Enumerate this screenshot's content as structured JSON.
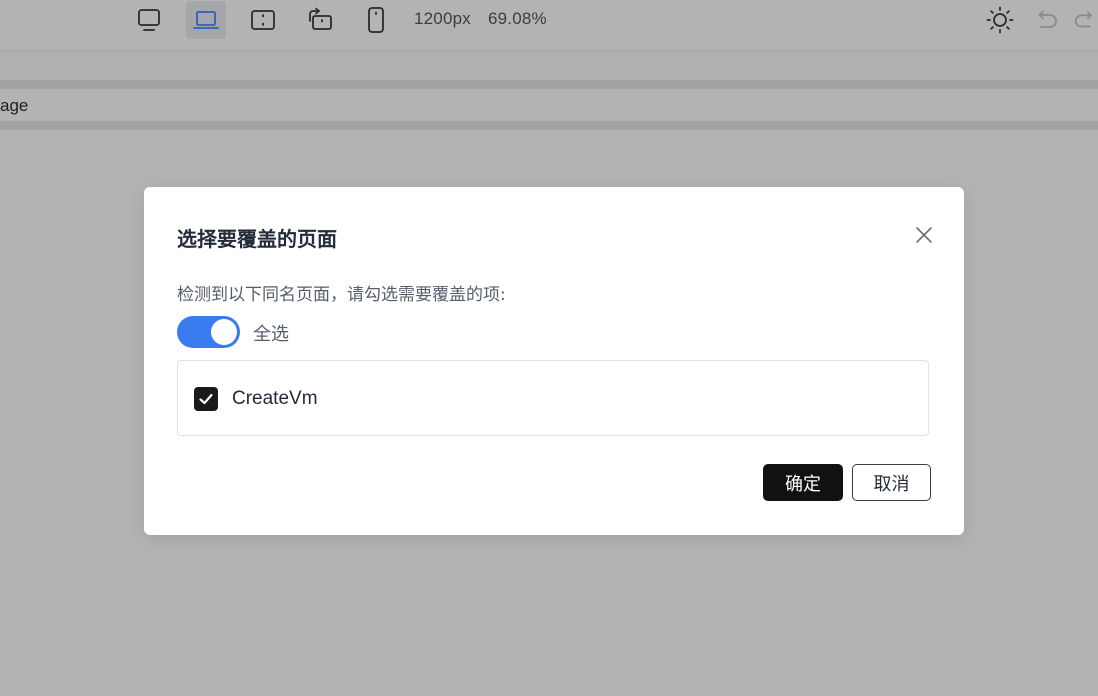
{
  "toolbar": {
    "devices": [
      {
        "icon": "monitor-icon",
        "active": false
      },
      {
        "icon": "laptop-icon",
        "active": true
      },
      {
        "icon": "tablet-landscape-icon",
        "active": false
      },
      {
        "icon": "tablet-rotate-icon",
        "active": false
      },
      {
        "icon": "phone-icon",
        "active": false
      }
    ],
    "width_readout": "1200px",
    "zoom_readout": "69.08%",
    "right_icons": [
      "sun-icon",
      "undo-icon",
      "redo-icon"
    ],
    "active_color": "#3a7cf0"
  },
  "page_bar": {
    "label": "age"
  },
  "dialog": {
    "title": "选择要覆盖的页面",
    "description": "检测到以下同名页面，请勾选需要覆盖的项:",
    "select_all": {
      "label": "全选",
      "on": true,
      "color": "#3a7cf0"
    },
    "items": [
      {
        "label": "CreateVm",
        "checked": true
      }
    ],
    "buttons": {
      "confirm": "确定",
      "cancel": "取消"
    }
  }
}
